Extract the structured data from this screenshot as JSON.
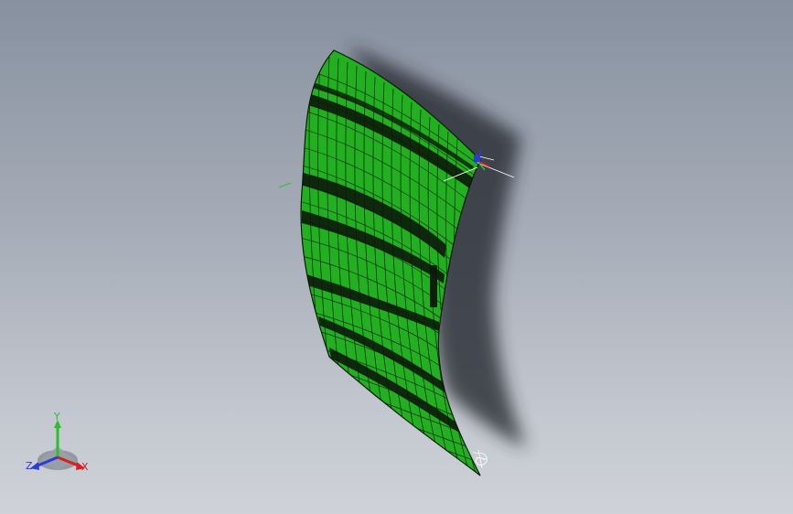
{
  "view": {
    "background_top": "#87919f",
    "background_bottom": "#cfd2d8",
    "part_color": "#22b021",
    "mesh_color": "#0b1a08"
  },
  "triad": {
    "x_label": "X",
    "y_label": "Y",
    "z_label": "Z",
    "x_color": "#d42020",
    "y_color": "#2bc02b",
    "z_color": "#2a3cd8"
  }
}
